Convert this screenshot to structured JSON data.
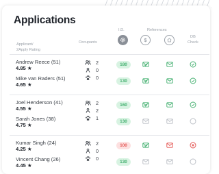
{
  "header": {
    "title": "Applications",
    "col_applicant": "Applicant/\n2Apply Rating",
    "col_occupants": "Occupants",
    "col_id": "I.D.",
    "col_references": "References",
    "col_db_check": "DB\nCheck"
  },
  "colors": {
    "green": "#3fae6c",
    "green_bg": "#d8f3e2",
    "red": "#e3524f",
    "red_bg": "#fde0e0",
    "gray": "#b9bdc4"
  },
  "groups": [
    {
      "applicants": [
        {
          "name": "Andrew Reece (51)",
          "rating": "4.85 ★",
          "id_score": "180",
          "id_status": "green",
          "ref1": "check",
          "ref2": "check",
          "db": "check"
        },
        {
          "name": "Mike van Raders (51)",
          "rating": "4.65 ★",
          "id_score": "130",
          "id_status": "green",
          "ref1": "check",
          "ref2": "check",
          "db": "check"
        }
      ],
      "occupants": {
        "adults": "2",
        "children": "0",
        "pets": "0"
      }
    },
    {
      "applicants": [
        {
          "name": "Joel Henderson (41)",
          "rating": "4.55 ★",
          "id_score": "160",
          "id_status": "green",
          "ref1": "check",
          "ref2": "check",
          "db": "check"
        },
        {
          "name": "Sarah Jones (38)",
          "rating": "4.75 ★",
          "id_score": "130",
          "id_status": "green",
          "ref1": "pending",
          "ref2": "pending",
          "db": "pending"
        }
      ],
      "occupants": {
        "adults": "2",
        "children": "2",
        "pets": "1"
      }
    },
    {
      "applicants": [
        {
          "name": "Kumar Singh (24)",
          "rating": "4.25 ★",
          "id_score": "100",
          "id_status": "red",
          "ref1": "check",
          "ref2": "fail",
          "db": "fail"
        },
        {
          "name": "Vincent Chang (26)",
          "rating": "4.45 ★",
          "id_score": "130",
          "id_status": "green",
          "ref1": "pending",
          "ref2": "pending",
          "db": "pending"
        }
      ],
      "occupants": {
        "adults": "2",
        "children": "0",
        "pets": "0"
      }
    }
  ]
}
